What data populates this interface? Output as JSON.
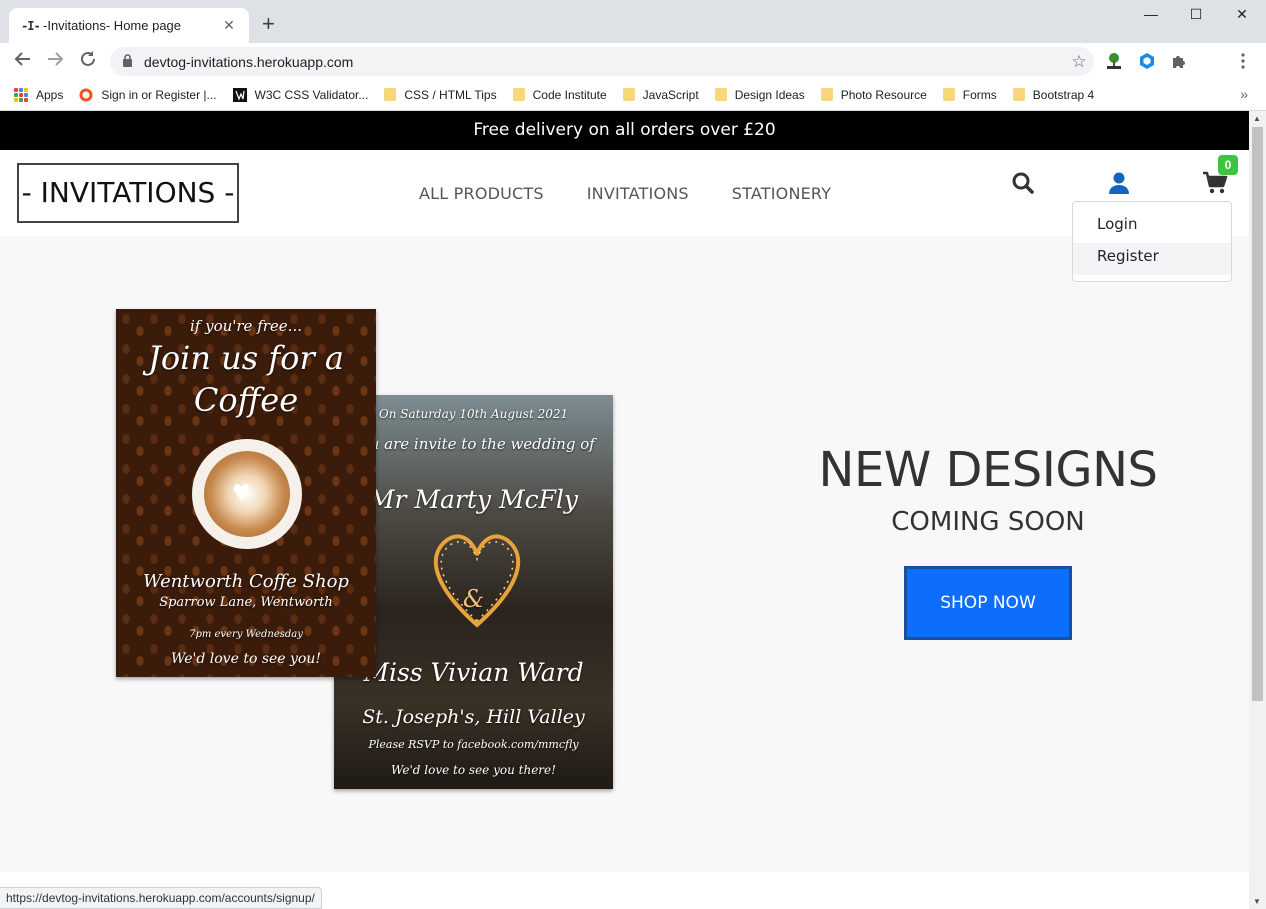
{
  "browser": {
    "tab_favicon": "-I-",
    "tab_title": "-Invitations- Home page",
    "tab_close": "✕",
    "new_tab": "+",
    "window_controls": [
      "—",
      "☐",
      "✕"
    ],
    "url": "devtog-invitations.herokuapp.com",
    "bookmarks": [
      {
        "label": "Apps",
        "icon": "apps-grid-icon"
      },
      {
        "label": "Sign in or Register |...",
        "icon": "ring-icon"
      },
      {
        "label": "W3C CSS Validator...",
        "icon": "w3c-icon"
      },
      {
        "label": "CSS / HTML Tips",
        "icon": "folder-icon"
      },
      {
        "label": "Code Institute",
        "icon": "folder-icon"
      },
      {
        "label": "JavaScript",
        "icon": "folder-icon"
      },
      {
        "label": "Design Ideas",
        "icon": "folder-icon"
      },
      {
        "label": "Photo Resource",
        "icon": "folder-icon"
      },
      {
        "label": "Forms",
        "icon": "folder-icon"
      },
      {
        "label": "Bootstrap 4",
        "icon": "folder-icon"
      }
    ],
    "bookmarks_more": "»",
    "status_url": "https://devtog-invitations.herokuapp.com/accounts/signup/"
  },
  "site": {
    "promo": "Free delivery on all orders over £20",
    "logo": "- INVITATIONS -",
    "nav": [
      "ALL PRODUCTS",
      "INVITATIONS",
      "STATIONERY"
    ],
    "cart_count": "0",
    "account_menu": [
      "Login",
      "Register"
    ],
    "colors": {
      "accent": "#0d6efd",
      "badge": "#3ec43e",
      "user_icon": "#1565c0"
    }
  },
  "hero": {
    "coffee_card": {
      "line1": "if you're free...",
      "line2": "Join us for a",
      "line3": "Coffee",
      "line4": "Wentworth Coffe Shop",
      "line5": "Sparrow Lane, Wentworth",
      "line6": "7pm every Wednesday",
      "line7": "We'd love to see you!"
    },
    "wedding_card": {
      "line1": "On Saturday 10th August 2021",
      "line2": "you are invite to the wedding of",
      "line3": "Mr Marty McFly",
      "amp": "&",
      "line4": "Miss Vivian Ward",
      "line5": "St. Joseph's, Hill Valley",
      "line6": "Please RSVP to facebook.com/mmcfly",
      "line7": "We'd love to see you there!"
    },
    "headline": "NEW DESIGNS",
    "subheadline": "COMING SOON",
    "cta": "SHOP NOW"
  }
}
